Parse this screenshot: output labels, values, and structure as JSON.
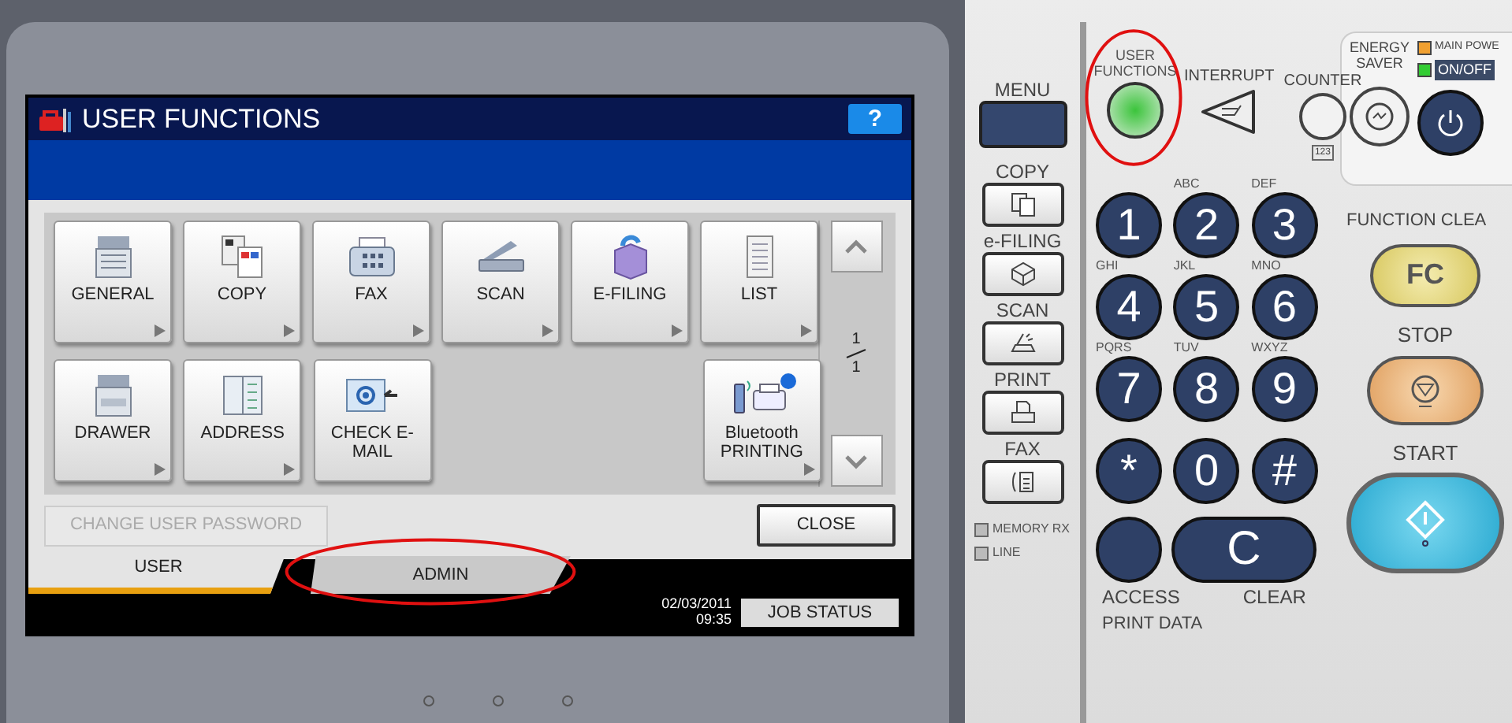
{
  "screen": {
    "title": "USER FUNCTIONS",
    "help": "?",
    "tiles": [
      {
        "label": "GENERAL",
        "arrow": true
      },
      {
        "label": "COPY",
        "arrow": true
      },
      {
        "label": "FAX",
        "arrow": true
      },
      {
        "label": "SCAN",
        "arrow": true
      },
      {
        "label": "E-FILING",
        "arrow": true
      },
      {
        "label": "LIST",
        "arrow": true
      },
      {
        "label": "DRAWER",
        "arrow": true
      },
      {
        "label": "ADDRESS",
        "arrow": true
      },
      {
        "label": "CHECK E-MAIL",
        "arrow": false
      },
      {
        "label": "Bluetooth PRINTING",
        "arrow": true
      }
    ],
    "page": {
      "current": "1",
      "total": "1"
    },
    "change_password": {
      "label": "CHANGE USER PASSWORD",
      "disabled": true
    },
    "close": "CLOSE",
    "tabs": [
      {
        "label": "USER",
        "selected": true,
        "highlighted": false
      },
      {
        "label": "ADMIN",
        "selected": false,
        "highlighted": true
      }
    ],
    "date": "02/03/2011",
    "time": "09:35",
    "job_status": "JOB STATUS"
  },
  "panel": {
    "mode_keys": [
      {
        "label": "MENU",
        "kind": "menu"
      },
      {
        "label": "COPY",
        "kind": "mode"
      },
      {
        "label": "e-FILING",
        "kind": "mode"
      },
      {
        "label": "SCAN",
        "kind": "mode"
      },
      {
        "label": "PRINT",
        "kind": "mode"
      },
      {
        "label": "FAX",
        "kind": "mode"
      }
    ],
    "indicators": [
      {
        "label": "MEMORY RX",
        "on": false
      },
      {
        "label": "LINE",
        "on": false
      }
    ],
    "user_functions": {
      "label": "USER FUNCTIONS",
      "on": true,
      "highlighted": true
    },
    "interrupt": "INTERRUPT",
    "counter": {
      "label": "COUNTER",
      "sub": "123"
    },
    "key_letters": [
      "ABC",
      "DEF",
      "GHI",
      "JKL",
      "MNO",
      "PQRS",
      "TUV",
      "WXYZ"
    ],
    "keypad": [
      "1",
      "2",
      "3",
      "4",
      "5",
      "6",
      "7",
      "8",
      "9",
      "*",
      "0",
      "#"
    ],
    "access": "ACCESS",
    "clear": {
      "key": "C",
      "label": "CLEAR"
    },
    "print_data": "PRINT DATA",
    "energy_saver": "ENERGY SAVER",
    "main_power": "MAIN POWE",
    "on_off": "ON/OFF",
    "function_clear": {
      "label": "FUNCTION CLEA",
      "key": "FC"
    },
    "stop": "STOP",
    "start": "START"
  }
}
